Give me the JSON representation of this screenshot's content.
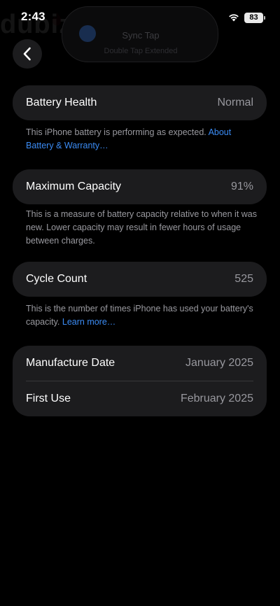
{
  "status_bar": {
    "time": "2:43",
    "battery_level": "83"
  },
  "watermark": {
    "text": "dubizzle"
  },
  "dynamic_island": {
    "title": "Sync Tap",
    "subtitle": "Double Tap Extended"
  },
  "cards": {
    "battery_health": {
      "label": "Battery Health",
      "value": "Normal",
      "footnote": "This iPhone battery is performing as expected. ",
      "link": "About Battery & Warranty…"
    },
    "maximum_capacity": {
      "label": "Maximum Capacity",
      "value": "91%",
      "footnote": "This is a measure of battery capacity relative to when it was new. Lower capacity may result in fewer hours of usage between charges."
    },
    "cycle_count": {
      "label": "Cycle Count",
      "value": "525",
      "footnote": "This is the number of times iPhone has used your battery's capacity. ",
      "link": "Learn more…"
    },
    "dates": {
      "manufacture_label": "Manufacture Date",
      "manufacture_value": "January 2025",
      "first_use_label": "First Use",
      "first_use_value": "February 2025"
    }
  },
  "icons": {
    "back": "chevron-left-icon",
    "wifi": "wifi-icon",
    "battery": "battery-icon"
  },
  "colors": {
    "background": "#000000",
    "card": "#1c1c1e",
    "secondary_text": "#98989e",
    "link": "#3b8cf5"
  }
}
